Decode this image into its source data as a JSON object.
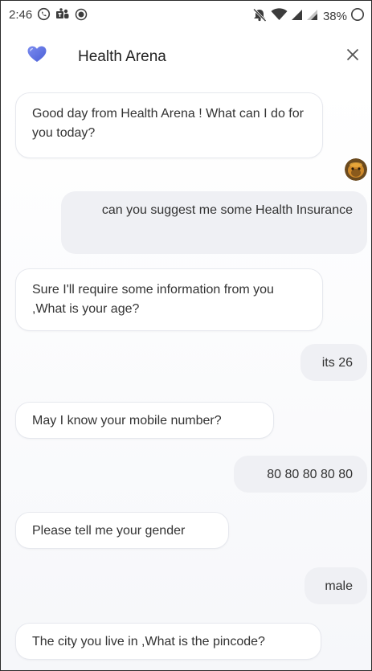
{
  "status_bar": {
    "time": "2:46",
    "battery": "38%"
  },
  "header": {
    "title": "Health Arena"
  },
  "messages": [
    {
      "sender": "bot",
      "text": "Good day from Health Arena ! What can I do for you today?"
    },
    {
      "sender": "user",
      "text": "can you suggest me some Health Insurance"
    },
    {
      "sender": "bot",
      "text": "Sure I'll require some information from you ,What is your age?"
    },
    {
      "sender": "user",
      "text": "its 26"
    },
    {
      "sender": "bot",
      "text": "May I know your mobile number?"
    },
    {
      "sender": "user",
      "text": "80 80 80 80 80"
    },
    {
      "sender": "bot",
      "text": "Please tell me your gender"
    },
    {
      "sender": "user",
      "text": "male"
    },
    {
      "sender": "bot",
      "text": "The city you live in ,What is the pincode?"
    }
  ],
  "icons": {
    "status_left": [
      "whatsapp-icon",
      "teams-icon",
      "record-icon"
    ],
    "status_right": [
      "mute-icon",
      "wifi-icon",
      "signal-icon",
      "battery-icon"
    ],
    "header": [
      "heart-logo-icon",
      "close-icon"
    ]
  },
  "colors": {
    "logo": "#6b7de0",
    "user_bubble": "#eff0f4",
    "bot_bubble_border": "#e6e8ee"
  }
}
